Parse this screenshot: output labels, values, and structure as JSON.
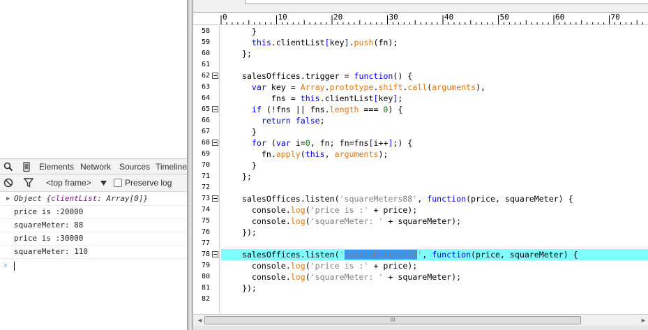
{
  "devtools": {
    "tabs": [
      "Elements",
      "Network",
      "Sources",
      "Timeline"
    ],
    "frame_selector": "<top frame>",
    "preserve_log_label": "Preserve log",
    "console": [
      {
        "kind": "object",
        "prefix": "Object ",
        "body_open": "{",
        "key": "clientList",
        "sep": ": ",
        "val": "Array[0]",
        "body_close": "}"
      },
      {
        "kind": "log",
        "text": "price is :20000"
      },
      {
        "kind": "log",
        "text": "squareMeter: 88"
      },
      {
        "kind": "log",
        "text": "price is :30000"
      },
      {
        "kind": "log",
        "text": "squareMeter: 110"
      }
    ],
    "prompt_glyph": "›"
  },
  "ruler": {
    "labels": [
      "0",
      "10",
      "20",
      "30",
      "40",
      "50",
      "60",
      "70"
    ]
  },
  "scrollbar": {
    "left_arrow": "◄",
    "grip": "III",
    "right_arrow": "►"
  },
  "code": {
    "highlight_line": 78,
    "lines": [
      {
        "n": 58,
        "fold": false,
        "tokens": [
          [
            "pu",
            "    }"
          ]
        ]
      },
      {
        "n": 59,
        "fold": false,
        "tokens": [
          [
            "pu",
            "    "
          ],
          [
            "kw",
            "this"
          ],
          [
            "pu",
            "."
          ],
          [
            "id",
            "clientList"
          ],
          [
            "kw",
            "["
          ],
          [
            "id",
            "key"
          ],
          [
            "kw",
            "]"
          ],
          [
            "pu",
            "."
          ],
          [
            "fn",
            "push"
          ],
          [
            "pu",
            "(fn);"
          ]
        ]
      },
      {
        "n": 60,
        "fold": false,
        "tokens": [
          [
            "pu",
            "  };"
          ]
        ]
      },
      {
        "n": 61,
        "fold": false,
        "tokens": []
      },
      {
        "n": 62,
        "fold": true,
        "tokens": [
          [
            "pu",
            "  salesOffices.trigger = "
          ],
          [
            "kw",
            "function"
          ],
          [
            "pu",
            "() {"
          ]
        ]
      },
      {
        "n": 63,
        "fold": false,
        "tokens": [
          [
            "pu",
            "    "
          ],
          [
            "kw",
            "var"
          ],
          [
            "pu",
            " key = "
          ],
          [
            "fn",
            "Array"
          ],
          [
            "pu",
            "."
          ],
          [
            "pr",
            "prototype"
          ],
          [
            "pu",
            "."
          ],
          [
            "fn",
            "shift"
          ],
          [
            "pu",
            "."
          ],
          [
            "fn",
            "call"
          ],
          [
            "pu",
            "("
          ],
          [
            "pr",
            "arguments"
          ],
          [
            "pu",
            "),"
          ]
        ]
      },
      {
        "n": 64,
        "fold": false,
        "tokens": [
          [
            "pu",
            "        fns = "
          ],
          [
            "kw",
            "this"
          ],
          [
            "pu",
            "."
          ],
          [
            "id",
            "clientList"
          ],
          [
            "kw",
            "["
          ],
          [
            "id",
            "key"
          ],
          [
            "kw",
            "]"
          ],
          [
            "pu",
            ";"
          ]
        ]
      },
      {
        "n": 65,
        "fold": true,
        "tokens": [
          [
            "pu",
            "    "
          ],
          [
            "kw",
            "if"
          ],
          [
            "pu",
            " (!fns || fns."
          ],
          [
            "pr",
            "length"
          ],
          [
            "pu",
            " === "
          ],
          [
            "num",
            "0"
          ],
          [
            "pu",
            ") {"
          ]
        ]
      },
      {
        "n": 66,
        "fold": false,
        "tokens": [
          [
            "pu",
            "      "
          ],
          [
            "kw",
            "return"
          ],
          [
            "pu",
            " "
          ],
          [
            "kw",
            "false"
          ],
          [
            "pu",
            ";"
          ]
        ]
      },
      {
        "n": 67,
        "fold": false,
        "tokens": [
          [
            "pu",
            "    }"
          ]
        ]
      },
      {
        "n": 68,
        "fold": true,
        "tokens": [
          [
            "pu",
            "    "
          ],
          [
            "kw",
            "for"
          ],
          [
            "pu",
            " ("
          ],
          [
            "kw",
            "var"
          ],
          [
            "pu",
            " i="
          ],
          [
            "num",
            "0"
          ],
          [
            "pu",
            ", fn; fn=fns"
          ],
          [
            "kw",
            "["
          ],
          [
            "pu",
            "i++"
          ],
          [
            "kw",
            "]"
          ],
          [
            "pu",
            ";) {"
          ]
        ]
      },
      {
        "n": 69,
        "fold": false,
        "tokens": [
          [
            "pu",
            "      fn."
          ],
          [
            "fn",
            "apply"
          ],
          [
            "pu",
            "("
          ],
          [
            "kw",
            "this"
          ],
          [
            "pu",
            ", "
          ],
          [
            "pr",
            "arguments"
          ],
          [
            "pu",
            ");"
          ]
        ]
      },
      {
        "n": 70,
        "fold": false,
        "tokens": [
          [
            "pu",
            "    }"
          ]
        ]
      },
      {
        "n": 71,
        "fold": false,
        "tokens": [
          [
            "pu",
            "  };"
          ]
        ]
      },
      {
        "n": 72,
        "fold": false,
        "tokens": []
      },
      {
        "n": 73,
        "fold": true,
        "tokens": [
          [
            "pu",
            "  salesOffices.listen("
          ],
          [
            "str",
            "'squareMeters88'"
          ],
          [
            "pu",
            ", "
          ],
          [
            "kw",
            "function"
          ],
          [
            "pu",
            "(price, squareMeter) {"
          ]
        ]
      },
      {
        "n": 74,
        "fold": false,
        "tokens": [
          [
            "pu",
            "    console."
          ],
          [
            "fn",
            "log"
          ],
          [
            "pu",
            "("
          ],
          [
            "str",
            "'price is :'"
          ],
          [
            "pu",
            " + price);"
          ]
        ]
      },
      {
        "n": 75,
        "fold": false,
        "tokens": [
          [
            "pu",
            "    console."
          ],
          [
            "fn",
            "log"
          ],
          [
            "pu",
            "("
          ],
          [
            "str",
            "'squareMeter: '"
          ],
          [
            "pu",
            " + squareMeter);"
          ]
        ]
      },
      {
        "n": 76,
        "fold": false,
        "tokens": [
          [
            "pu",
            "  });"
          ]
        ]
      },
      {
        "n": 77,
        "fold": false,
        "tokens": []
      },
      {
        "n": 78,
        "fold": true,
        "tokens": [
          [
            "pu",
            "  salesOffices.listen("
          ],
          [
            "str",
            "'"
          ],
          [
            "sel",
            "squareMeters110"
          ],
          [
            "str",
            "'"
          ],
          [
            "pu",
            ", "
          ],
          [
            "kw",
            "function"
          ],
          [
            "pu",
            "(price, squareMeter) {"
          ]
        ]
      },
      {
        "n": 79,
        "fold": false,
        "tokens": [
          [
            "pu",
            "    console."
          ],
          [
            "fn",
            "log"
          ],
          [
            "pu",
            "("
          ],
          [
            "str",
            "'price is :'"
          ],
          [
            "pu",
            " + price);"
          ]
        ]
      },
      {
        "n": 80,
        "fold": false,
        "tokens": [
          [
            "pu",
            "    console."
          ],
          [
            "fn",
            "log"
          ],
          [
            "pu",
            "("
          ],
          [
            "str",
            "'squareMeter: '"
          ],
          [
            "pu",
            " + squareMeter);"
          ]
        ]
      },
      {
        "n": 81,
        "fold": false,
        "tokens": [
          [
            "pu",
            "  });"
          ]
        ]
      },
      {
        "n": 82,
        "fold": false,
        "tokens": []
      }
    ]
  }
}
